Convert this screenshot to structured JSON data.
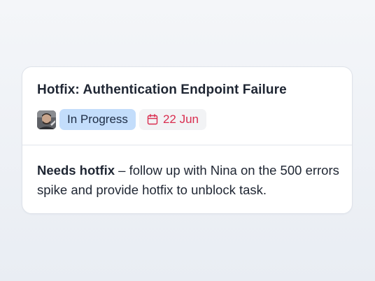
{
  "card": {
    "title": "Hotfix: Authentication Endpoint Failure",
    "status": "In Progress",
    "due_date": "22 Jun",
    "date_icon": "calendar-icon",
    "avatar_icon": "user-avatar",
    "note_strong": "Needs hotfix",
    "note_text": " – follow up with Nina on the 500 errors spike and provide hotfix to unblock task."
  },
  "colors": {
    "status_bg": "#c3ddfb",
    "date_text": "#d92d4f",
    "date_bg": "#f2f3f5"
  }
}
